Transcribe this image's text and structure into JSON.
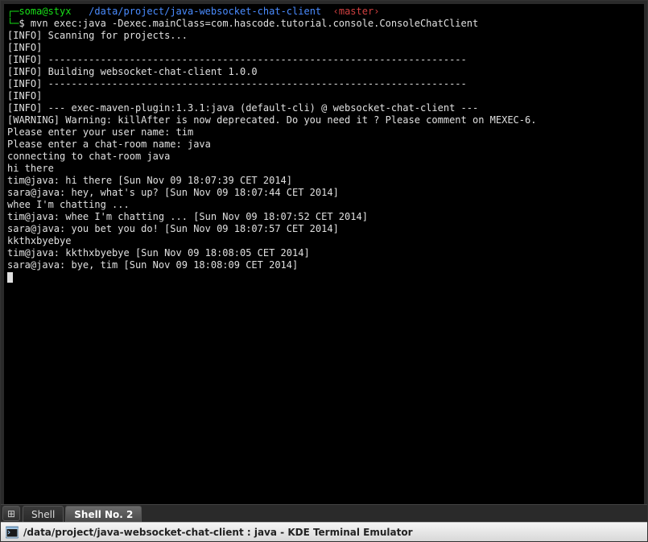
{
  "prompt": {
    "corner_open": "┌─",
    "user_host": "soma@styx",
    "cwd": "/data/project/java-websocket-chat-client",
    "branch_open": "‹",
    "branch": "master",
    "branch_close": "›",
    "line2_prefix": "└─",
    "shell_symbol": "$ ",
    "command": "mvn exec:java -Dexec.mainClass=com.hascode.tutorial.console.ConsoleChatClient"
  },
  "output": [
    "[INFO] Scanning for projects...",
    "[INFO]                                                                         ",
    "[INFO] ------------------------------------------------------------------------",
    "[INFO] Building websocket-chat-client 1.0.0",
    "[INFO] ------------------------------------------------------------------------",
    "[INFO] ",
    "[INFO] --- exec-maven-plugin:1.3.1:java (default-cli) @ websocket-chat-client ---",
    "[WARNING] Warning: killAfter is now deprecated. Do you need it ? Please comment on MEXEC-6.",
    "Please enter your user name: tim",
    "Please enter a chat-room name: java",
    "connecting to chat-room java",
    "hi there",
    "tim@java: hi there [Sun Nov 09 18:07:39 CET 2014]",
    "sara@java: hey, what's up? [Sun Nov 09 18:07:44 CET 2014]",
    "whee I'm chatting ...",
    "tim@java: whee I'm chatting ... [Sun Nov 09 18:07:52 CET 2014]",
    "sara@java: you bet you do! [Sun Nov 09 18:07:57 CET 2014]",
    "kkthxbyebye",
    "tim@java: kkthxbyebye [Sun Nov 09 18:08:05 CET 2014]",
    "sara@java: bye, tim [Sun Nov 09 18:08:09 CET 2014]"
  ],
  "tabs": {
    "new_tab_glyph": "⊞",
    "items": [
      {
        "label": "Shell",
        "active": false
      },
      {
        "label": "Shell No. 2",
        "active": true
      }
    ]
  },
  "titlebar": {
    "text": "/data/project/java-websocket-chat-client : java - KDE Terminal Emulator"
  }
}
